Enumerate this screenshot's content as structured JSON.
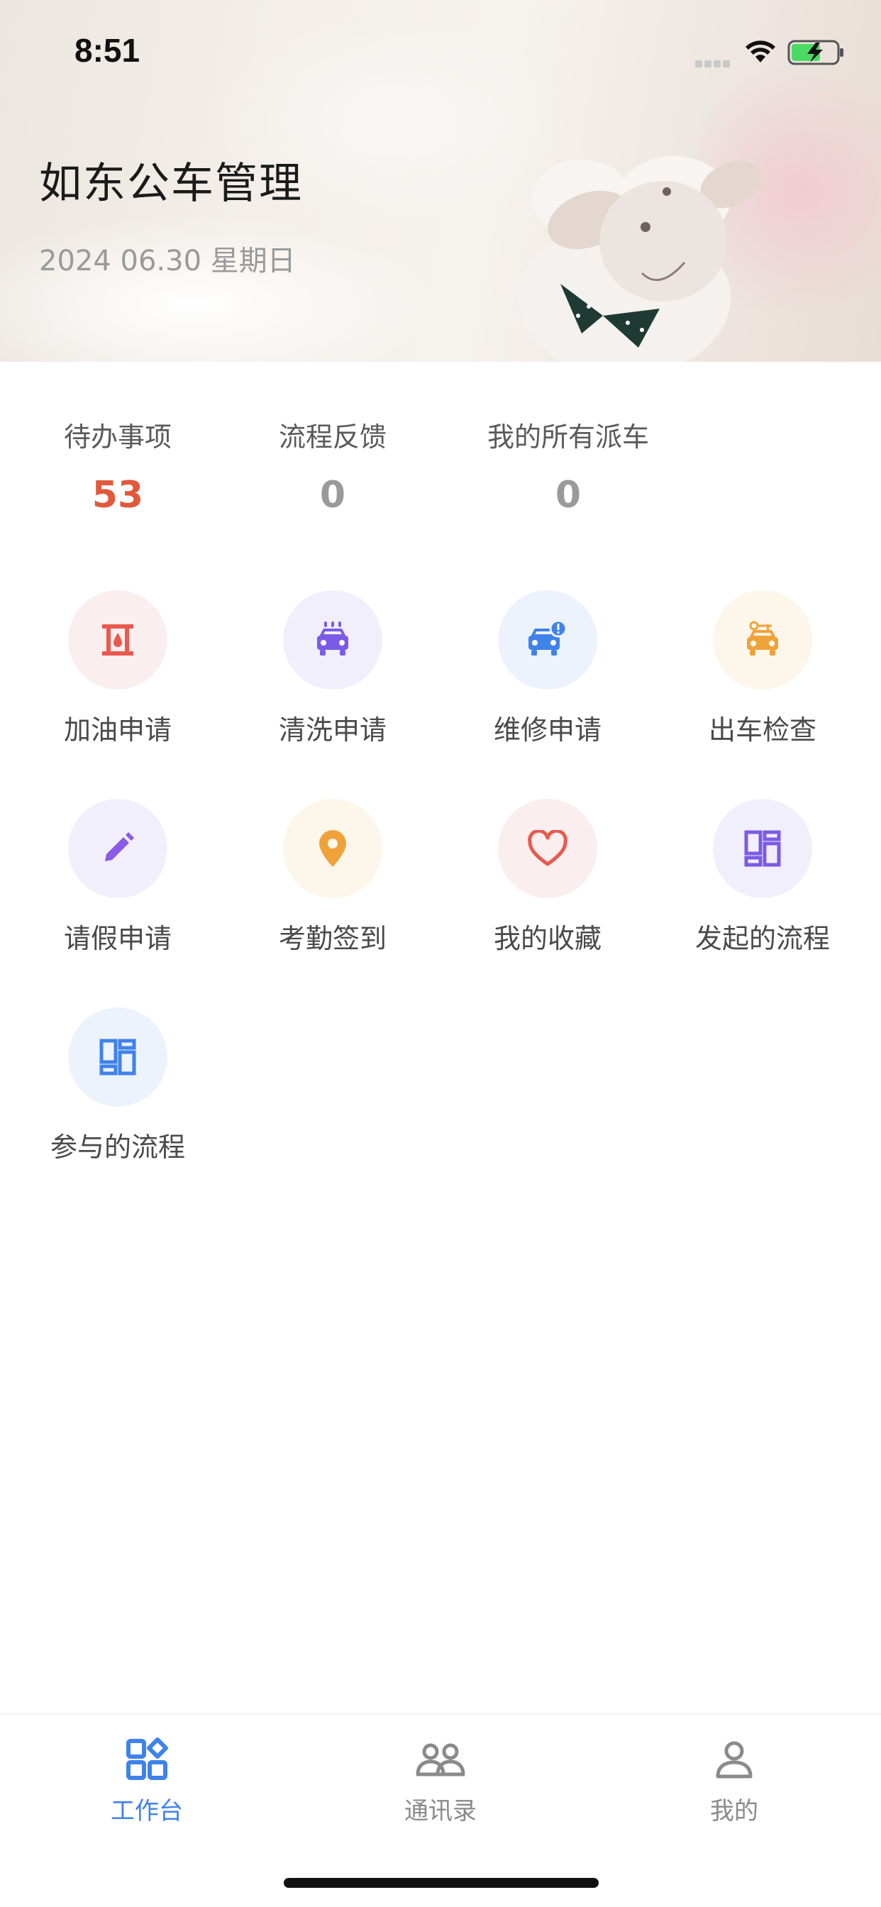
{
  "status_bar": {
    "time": "8:51"
  },
  "header": {
    "title": "如东公车管理",
    "date": "2024 06.30 星期日"
  },
  "stats": [
    {
      "label": "待办事项",
      "value": "53"
    },
    {
      "label": "流程反馈",
      "value": "0"
    },
    {
      "label": "我的所有派车",
      "value": "0"
    }
  ],
  "functions": [
    {
      "label": "加油申请",
      "icon": "fuel-icon",
      "color": "#e85a4f"
    },
    {
      "label": "清洗申请",
      "icon": "car-wash-icon",
      "color": "#7b5be6"
    },
    {
      "label": "维修申请",
      "icon": "car-repair-icon",
      "color": "#3f82ea"
    },
    {
      "label": "出车检查",
      "icon": "car-inspect-icon",
      "color": "#f0a23a"
    },
    {
      "label": "请假申请",
      "icon": "pencil-icon",
      "color": "#8a5be6"
    },
    {
      "label": "考勤签到",
      "icon": "location-pin-icon",
      "color": "#f0a23a"
    },
    {
      "label": "我的收藏",
      "icon": "heart-icon",
      "color": "#e85a4f"
    },
    {
      "label": "发起的流程",
      "icon": "dashboard-grid-icon",
      "color": "#7b5be6"
    },
    {
      "label": "参与的流程",
      "icon": "dashboard-grid-icon",
      "color": "#3f82ea"
    }
  ],
  "tabbar": {
    "items": [
      {
        "label": "工作台",
        "icon": "workbench-icon",
        "active": true
      },
      {
        "label": "通讯录",
        "icon": "contacts-icon",
        "active": false
      },
      {
        "label": "我的",
        "icon": "profile-icon",
        "active": false
      }
    ],
    "active_color": "#3f82ea",
    "inactive_color": "#8a8a8a"
  }
}
